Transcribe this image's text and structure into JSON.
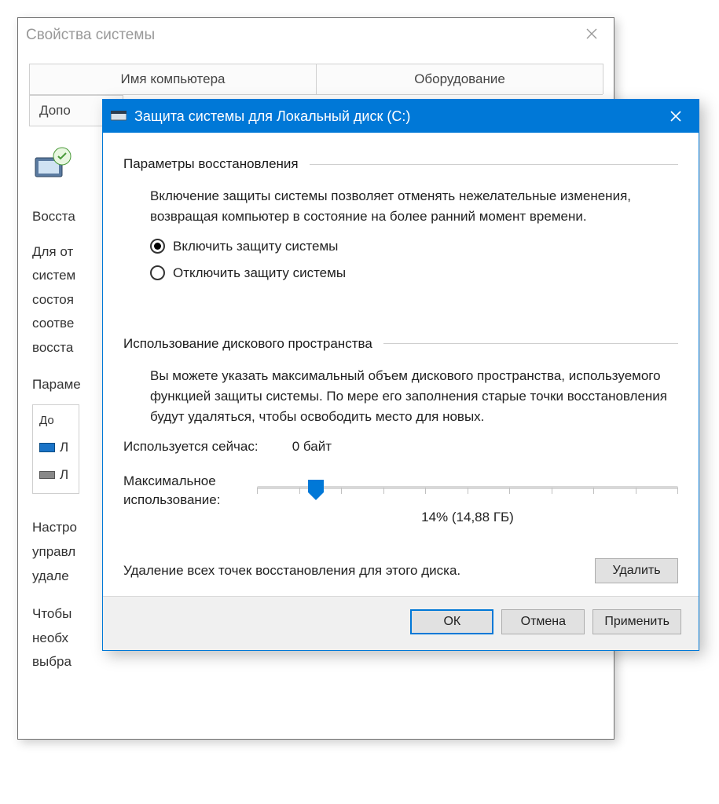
{
  "parent": {
    "title": "Свойства системы",
    "tab_computer_name": "Имя компьютера",
    "tab_hardware": "Оборудование",
    "tab_advanced": "Допо",
    "section_restore": "Восста",
    "para1": "Для от\nсистем\nсостоя\nсоотве\nвосста",
    "label_params": "Параме",
    "drives_header": "До",
    "drive1": "Л",
    "drive2": "Л",
    "para2": "Настро\nуправл\nудале",
    "para3": "Чтобы\nнеобх\nвыбра"
  },
  "dialog": {
    "title": "Защита системы для Локальный диск (C:)",
    "group_restore": "Параметры восстановления",
    "restore_desc": "Включение защиты системы позволяет отменять нежелательные изменения, возвращая компьютер в состояние на более ранний момент времени.",
    "radio_enable": "Включить защиту системы",
    "radio_disable": "Отключить защиту системы",
    "group_disk": "Использование дискового пространства",
    "disk_desc": "Вы можете указать максимальный объем дискового пространства, используемого функцией защиты системы. По мере его заполнения старые точки восстановления будут удаляться, чтобы освободить место для новых.",
    "used_now_label": "Используется сейчас:",
    "used_now_value": "0 байт",
    "max_usage_label": "Максимальное использование:",
    "slider_percent": 14,
    "slider_value_text": "14% (14,88 ГБ)",
    "delete_desc": "Удаление всех точек восстановления для этого диска.",
    "btn_delete": "Удалить",
    "btn_ok": "ОК",
    "btn_cancel": "Отмена",
    "btn_apply": "Применить"
  }
}
